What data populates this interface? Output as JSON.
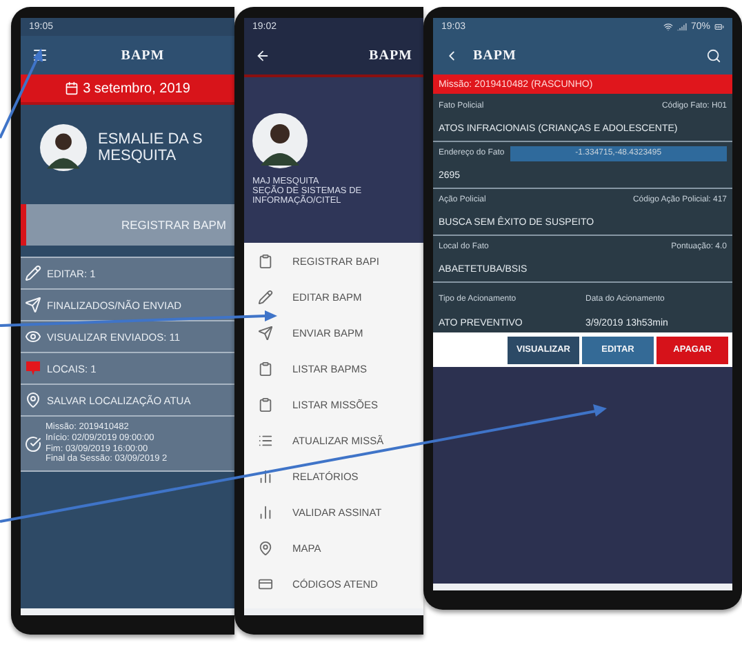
{
  "phones": [
    {
      "kind": "dashboard",
      "status_time": "19:05",
      "logo": "BAPM",
      "date": "3 setembro, 2019",
      "user_lines": [
        "ESMALIE DA S",
        "MESQUITA"
      ],
      "primary_button": "REGISTRAR BAPM",
      "menu": [
        {
          "kind": "edit",
          "label": "EDITAR: 1"
        },
        {
          "kind": "send",
          "label": "FINALIZADOS/NÃO ENVIAD"
        },
        {
          "kind": "view",
          "label": "VISUALIZAR ENVIADOS: 11"
        },
        {
          "kind": "places",
          "label": "LOCAIS: 1"
        },
        {
          "kind": "pin",
          "label": "SALVAR LOCALIZAÇÃO ATUA"
        }
      ],
      "mission": [
        "Missão: 2019410482",
        "Início: 02/09/2019 09:00:00",
        "Fim: 03/09/2019 16:00:00",
        "Final da Sessão: 03/09/2019 2"
      ]
    },
    {
      "kind": "drawer",
      "status_time": "19:02",
      "logo": "BAPM",
      "profile_lines": [
        "MAJ MESQUITA",
        "SEÇÃO DE SISTEMAS DE",
        "INFORMAÇÃO/CITEL"
      ],
      "menu": [
        {
          "kind": "clipboard",
          "label": "REGISTRAR BAPI"
        },
        {
          "kind": "edit",
          "label": "EDITAR BAPM"
        },
        {
          "kind": "send",
          "label": "ENVIAR BAPM"
        },
        {
          "kind": "clipboard",
          "label": "LISTAR BAPMS"
        },
        {
          "kind": "clipboard",
          "label": "LISTAR MISSÕES"
        },
        {
          "kind": "list",
          "label": "ATUALIZAR MISSÃ"
        },
        {
          "kind": "chart",
          "label": "RELATÓRIOS"
        },
        {
          "kind": "chart",
          "label": "VALIDAR ASSINAT"
        },
        {
          "kind": "pin",
          "label": "MAPA"
        },
        {
          "kind": "card",
          "label": "CÓDIGOS ATEND"
        }
      ]
    },
    {
      "kind": "detail",
      "status_time": "19:03",
      "battery": "70%",
      "logo": "BAPM",
      "banner": "Missão: 2019410482 (RASCUNHO)",
      "rows": [
        {
          "kind": "pair",
          "left": "Fato Policial",
          "right": "Código Fato: H01"
        },
        {
          "kind": "value",
          "text": "ATOS INFRACIONAIS (CRIANÇAS E ADOLESCENTE)"
        },
        {
          "kind": "field",
          "label": "Endereço do Fato",
          "value": "-1.334715,-48.4323495"
        },
        {
          "kind": "value",
          "text": "2695"
        },
        {
          "kind": "pair",
          "left": "Ação Policial",
          "right": "Código Ação Policial: 417"
        },
        {
          "kind": "value",
          "text": "BUSCA SEM ÊXITO DE SUSPEITO"
        },
        {
          "kind": "pair",
          "left": "Local do Fato",
          "right": "Pontuação: 4.0"
        },
        {
          "kind": "value",
          "text": "ABAETETUBA/BSIS"
        },
        {
          "kind": "columns",
          "left": "Tipo de Acionamento",
          "right": "Data do Acionamento"
        },
        {
          "kind": "columns_value",
          "left": "ATO PREVENTIVO",
          "right": "3/9/2019 13h53min"
        }
      ],
      "buttons": [
        {
          "kind": "view",
          "label": "VISUALIZAR"
        },
        {
          "kind": "edit",
          "label": "EDITAR"
        },
        {
          "kind": "delete",
          "label": "APAGAR"
        }
      ]
    }
  ]
}
